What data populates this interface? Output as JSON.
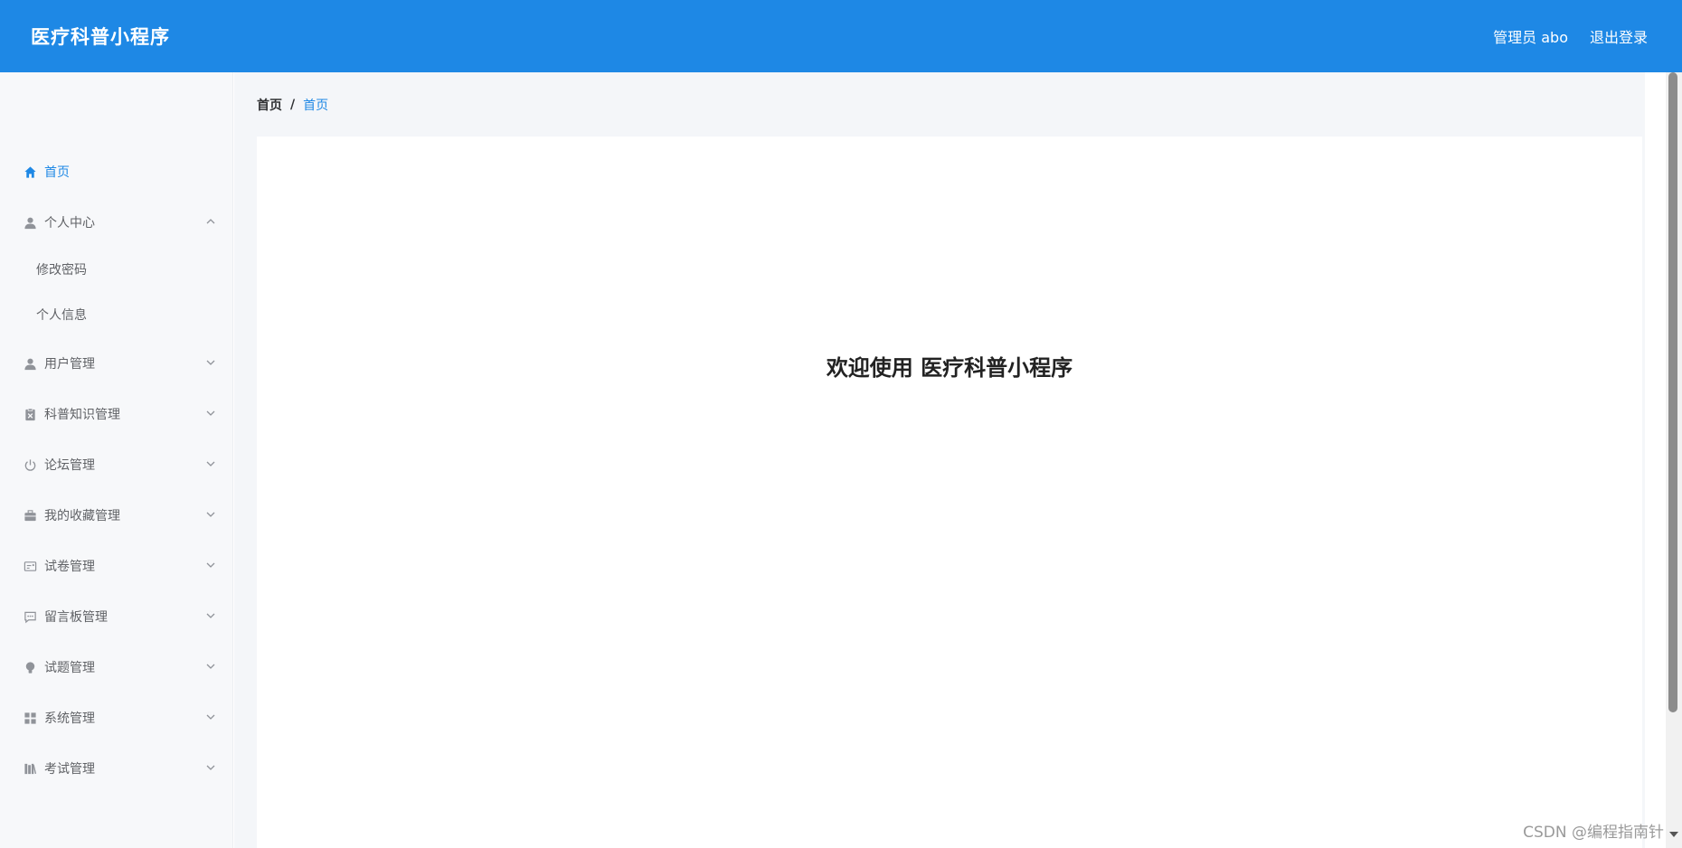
{
  "header": {
    "app_title": "医疗科普小程序",
    "user_label": "管理员 abo",
    "logout_label": "退出登录"
  },
  "sidebar": {
    "items": [
      {
        "label": "首页",
        "icon": "home-icon",
        "active": true
      },
      {
        "label": "个人中心",
        "icon": "user-icon",
        "expanded": true,
        "children": [
          {
            "label": "修改密码"
          },
          {
            "label": "个人信息"
          }
        ]
      },
      {
        "label": "用户管理",
        "icon": "user-icon"
      },
      {
        "label": "科普知识管理",
        "icon": "clipboard-icon"
      },
      {
        "label": "论坛管理",
        "icon": "power-icon"
      },
      {
        "label": "我的收藏管理",
        "icon": "briefcase-icon"
      },
      {
        "label": "试卷管理",
        "icon": "card-icon"
      },
      {
        "label": "留言板管理",
        "icon": "chat-icon"
      },
      {
        "label": "试题管理",
        "icon": "bulb-icon"
      },
      {
        "label": "系统管理",
        "icon": "grid-icon"
      },
      {
        "label": "考试管理",
        "icon": "books-icon"
      }
    ]
  },
  "breadcrumb": {
    "home": "首页",
    "separator": "/",
    "current": "首页"
  },
  "main": {
    "welcome": "欢迎使用 医疗科普小程序"
  },
  "watermark": "CSDN @编程指南针",
  "colors": {
    "accent": "#1e88e5",
    "sidebar_bg": "#f7f8fa",
    "content_bg": "#f4f6f9"
  }
}
